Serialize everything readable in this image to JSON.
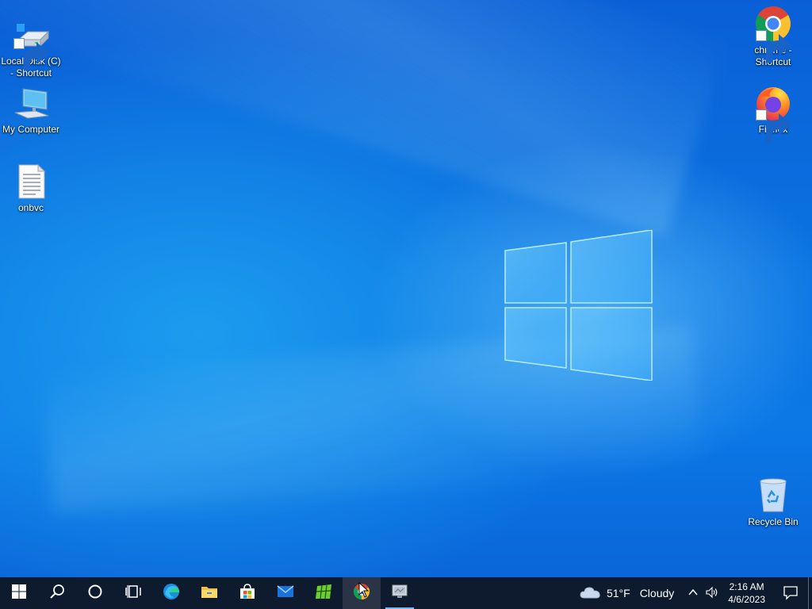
{
  "desktop": {
    "icons_left": [
      {
        "id": "local-disk",
        "label_line1": "Local Disk (C)",
        "label_line2": "- Shortcut",
        "icon": "drive-icon",
        "shortcut": true
      },
      {
        "id": "my-computer",
        "label_line1": "My Computer",
        "label_line2": "",
        "icon": "computer-icon",
        "shortcut": false
      },
      {
        "id": "onbvc",
        "label_line1": "onbvc",
        "label_line2": "",
        "icon": "text-file-icon",
        "shortcut": false
      }
    ],
    "icons_right": [
      {
        "id": "chrome",
        "label_line1": "chrome -",
        "label_line2": "Shortcut",
        "icon": "chrome-icon",
        "shortcut": true
      },
      {
        "id": "firefox",
        "label_line1": "Firefox",
        "label_line2": "",
        "icon": "firefox-icon",
        "shortcut": true
      },
      {
        "id": "recycle-bin",
        "label_line1": "Recycle Bin",
        "label_line2": "",
        "icon": "recycle-bin-icon",
        "shortcut": false
      }
    ]
  },
  "taskbar": {
    "buttons": [
      {
        "id": "start",
        "icon": "windows-start-icon"
      },
      {
        "id": "search",
        "icon": "search-icon"
      },
      {
        "id": "cortana",
        "icon": "cortana-icon"
      },
      {
        "id": "task-view",
        "icon": "task-view-icon"
      },
      {
        "id": "edge",
        "icon": "edge-icon"
      },
      {
        "id": "file-explorer",
        "icon": "folder-icon"
      },
      {
        "id": "store",
        "icon": "store-icon"
      },
      {
        "id": "mail",
        "icon": "mail-icon"
      },
      {
        "id": "app-green",
        "icon": "green-app-icon"
      },
      {
        "id": "chrome",
        "icon": "chrome-icon",
        "active": true
      },
      {
        "id": "app-monitor",
        "icon": "monitor-app-icon",
        "running": true
      }
    ],
    "tray": {
      "weather_temp": "51°F",
      "weather_desc": "Cloudy",
      "time": "2:16 AM",
      "date": "4/6/2023"
    }
  },
  "colors": {
    "taskbar_bg": "#0e1a2e",
    "accent_underline": "#76b9ed",
    "desktop_blue": "#0a74e2"
  }
}
